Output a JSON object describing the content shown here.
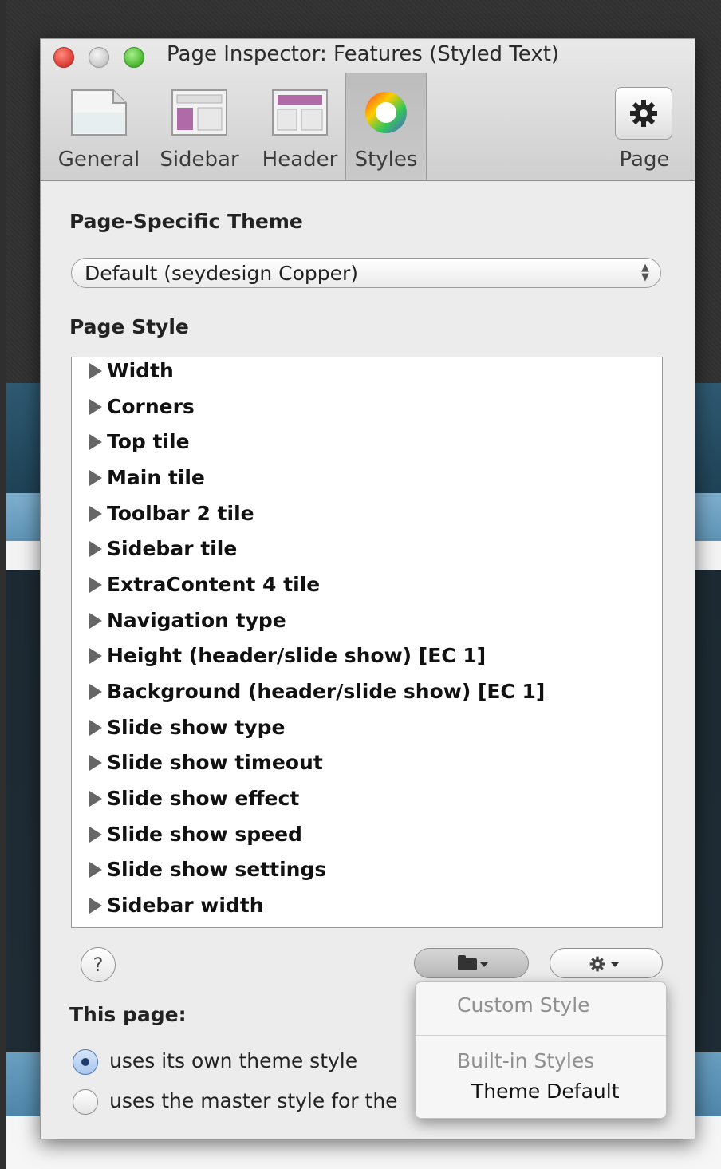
{
  "window": {
    "title": "Page Inspector: Features (Styled Text)"
  },
  "toolbar": {
    "tabs": [
      {
        "label": "General",
        "icon": "general-page-icon"
      },
      {
        "label": "Sidebar",
        "icon": "sidebar-layout-icon"
      },
      {
        "label": "Header",
        "icon": "header-layout-icon"
      },
      {
        "label": "Styles",
        "icon": "color-wheel-icon",
        "active": true
      }
    ],
    "page_button": {
      "label": "Page",
      "icon": "gear-icon"
    }
  },
  "theme": {
    "heading": "Page-Specific Theme",
    "selected": "Default (seydesign Copper)"
  },
  "page_style": {
    "heading": "Page Style",
    "items": [
      "Width",
      "Corners",
      "Top tile",
      "Main tile",
      "Toolbar 2 tile",
      "Sidebar tile",
      "ExtraContent 4 tile",
      "Navigation type",
      "Height (header/slide show) [EC 1]",
      "Background (header/slide show) [EC 1]",
      "Slide show type",
      "Slide show timeout",
      "Slide show effect",
      "Slide show speed",
      "Slide show settings",
      "Sidebar width"
    ]
  },
  "bottom": {
    "help_label": "?",
    "this_page_heading": "This page:",
    "options": [
      {
        "label": "uses its own theme style",
        "selected": true
      },
      {
        "label": "uses the master style for the",
        "selected": false
      }
    ]
  },
  "menu": {
    "custom_style": "Custom Style",
    "builtin_header": "Built-in Styles",
    "theme_default": "Theme Default"
  },
  "colors": {
    "panel_bg": "#ececec",
    "accent_blue": "#4d78b4",
    "close_red": "#e0443a",
    "zoom_green": "#54bf3b"
  }
}
